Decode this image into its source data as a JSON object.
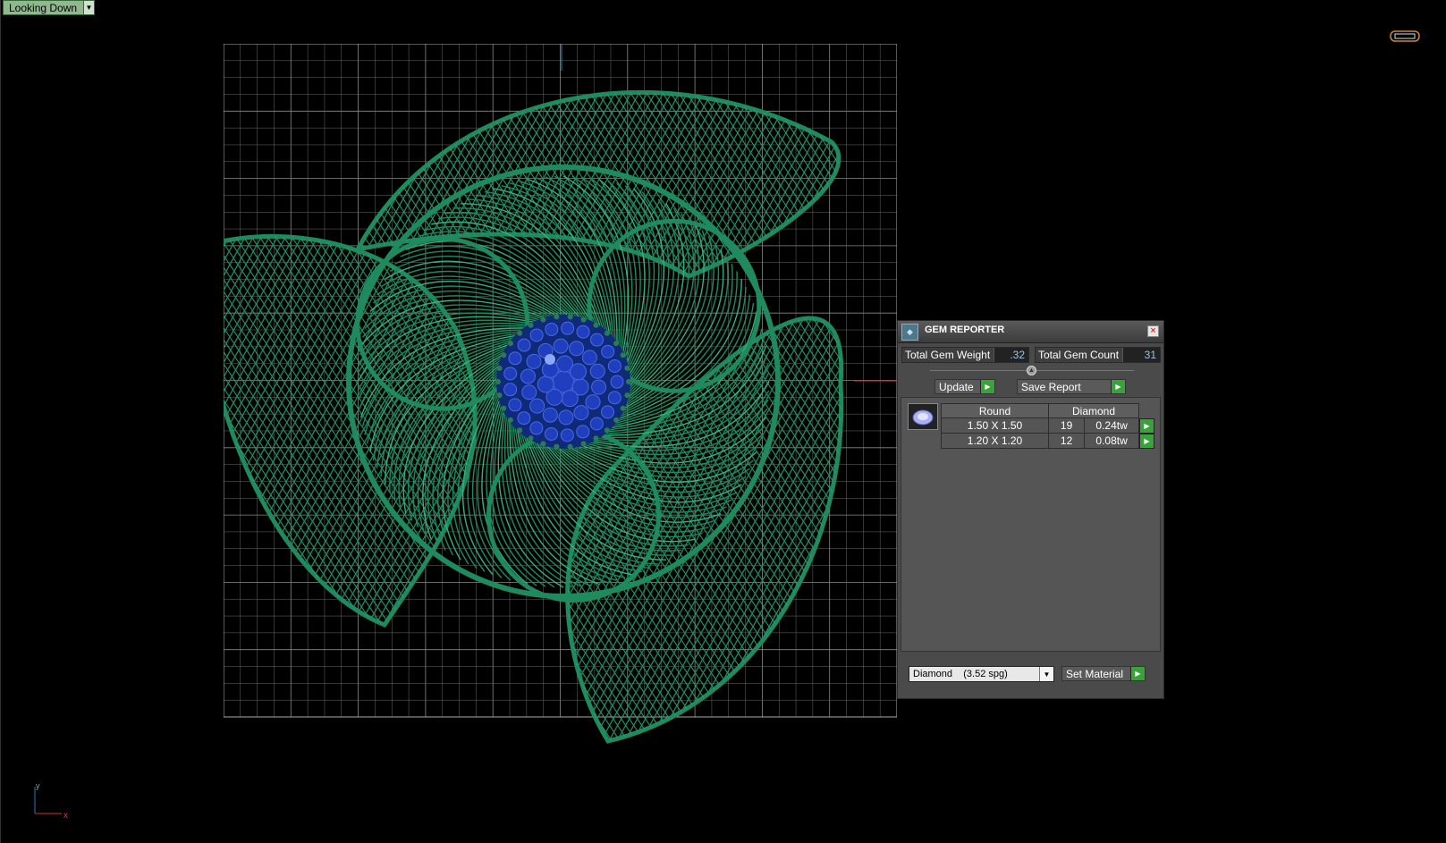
{
  "viewport": {
    "view_mode": "Looking Down",
    "axis": {
      "y_label": "y",
      "x_label": "x"
    }
  },
  "gem_reporter": {
    "title": "GEM REPORTER",
    "total_weight_label": "Total Gem Weight",
    "total_weight_value": ".32",
    "total_count_label": "Total Gem Count",
    "total_count_value": "31",
    "update_label": "Update",
    "save_report_label": "Save Report",
    "table": {
      "headers": [
        "Round",
        "Diamond"
      ],
      "rows": [
        {
          "size": "1.50 X 1.50",
          "count": "19",
          "weight": "0.24tw"
        },
        {
          "size": "1.20 X 1.20",
          "count": "12",
          "weight": "0.08tw"
        }
      ]
    },
    "material_value": "Diamond    (3.52 spg)",
    "set_material_label": "Set Material"
  },
  "colors": {
    "metal": "#1f8a5e",
    "gem": "#1f3fbf",
    "grid": "#6a6a6a",
    "button_play": "#3aa23a"
  }
}
